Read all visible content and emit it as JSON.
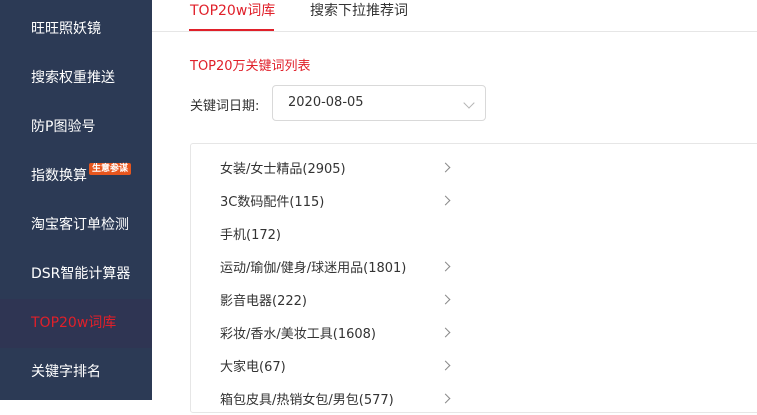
{
  "sidebar": {
    "items": [
      {
        "label": "旺旺照妖镜"
      },
      {
        "label": "搜索权重推送"
      },
      {
        "label": "防P图验号"
      },
      {
        "label": "指数换算",
        "badge": "生意参谋"
      },
      {
        "label": "淘宝客订单检测"
      },
      {
        "label": "DSR智能计算器"
      },
      {
        "label": "TOP20w词库",
        "active": true
      },
      {
        "label": "关键字排名"
      }
    ]
  },
  "tabs": [
    {
      "label": "TOP20w词库",
      "active": true
    },
    {
      "label": "搜索下拉推荐词",
      "active": false
    }
  ],
  "main": {
    "section_title": "TOP20万关键词列表",
    "date_label": "关键词日期:",
    "date_value": "2020-08-05"
  },
  "categories": [
    {
      "label": "女装/女士精品(2905)",
      "has_arrow": true
    },
    {
      "label": "3C数码配件(115)",
      "has_arrow": true
    },
    {
      "label": "手机(172)",
      "has_arrow": false
    },
    {
      "label": "运动/瑜伽/健身/球迷用品(1801)",
      "has_arrow": true
    },
    {
      "label": "影音电器(222)",
      "has_arrow": true
    },
    {
      "label": "彩妆/香水/美妆工具(1608)",
      "has_arrow": true
    },
    {
      "label": "大家电(67)",
      "has_arrow": true
    },
    {
      "label": "箱包皮具/热销女包/男包(577)",
      "has_arrow": true
    }
  ],
  "colors": {
    "sidebar_bg": "#2c3a55",
    "accent": "#e0202a",
    "badge": "#e8561e"
  }
}
